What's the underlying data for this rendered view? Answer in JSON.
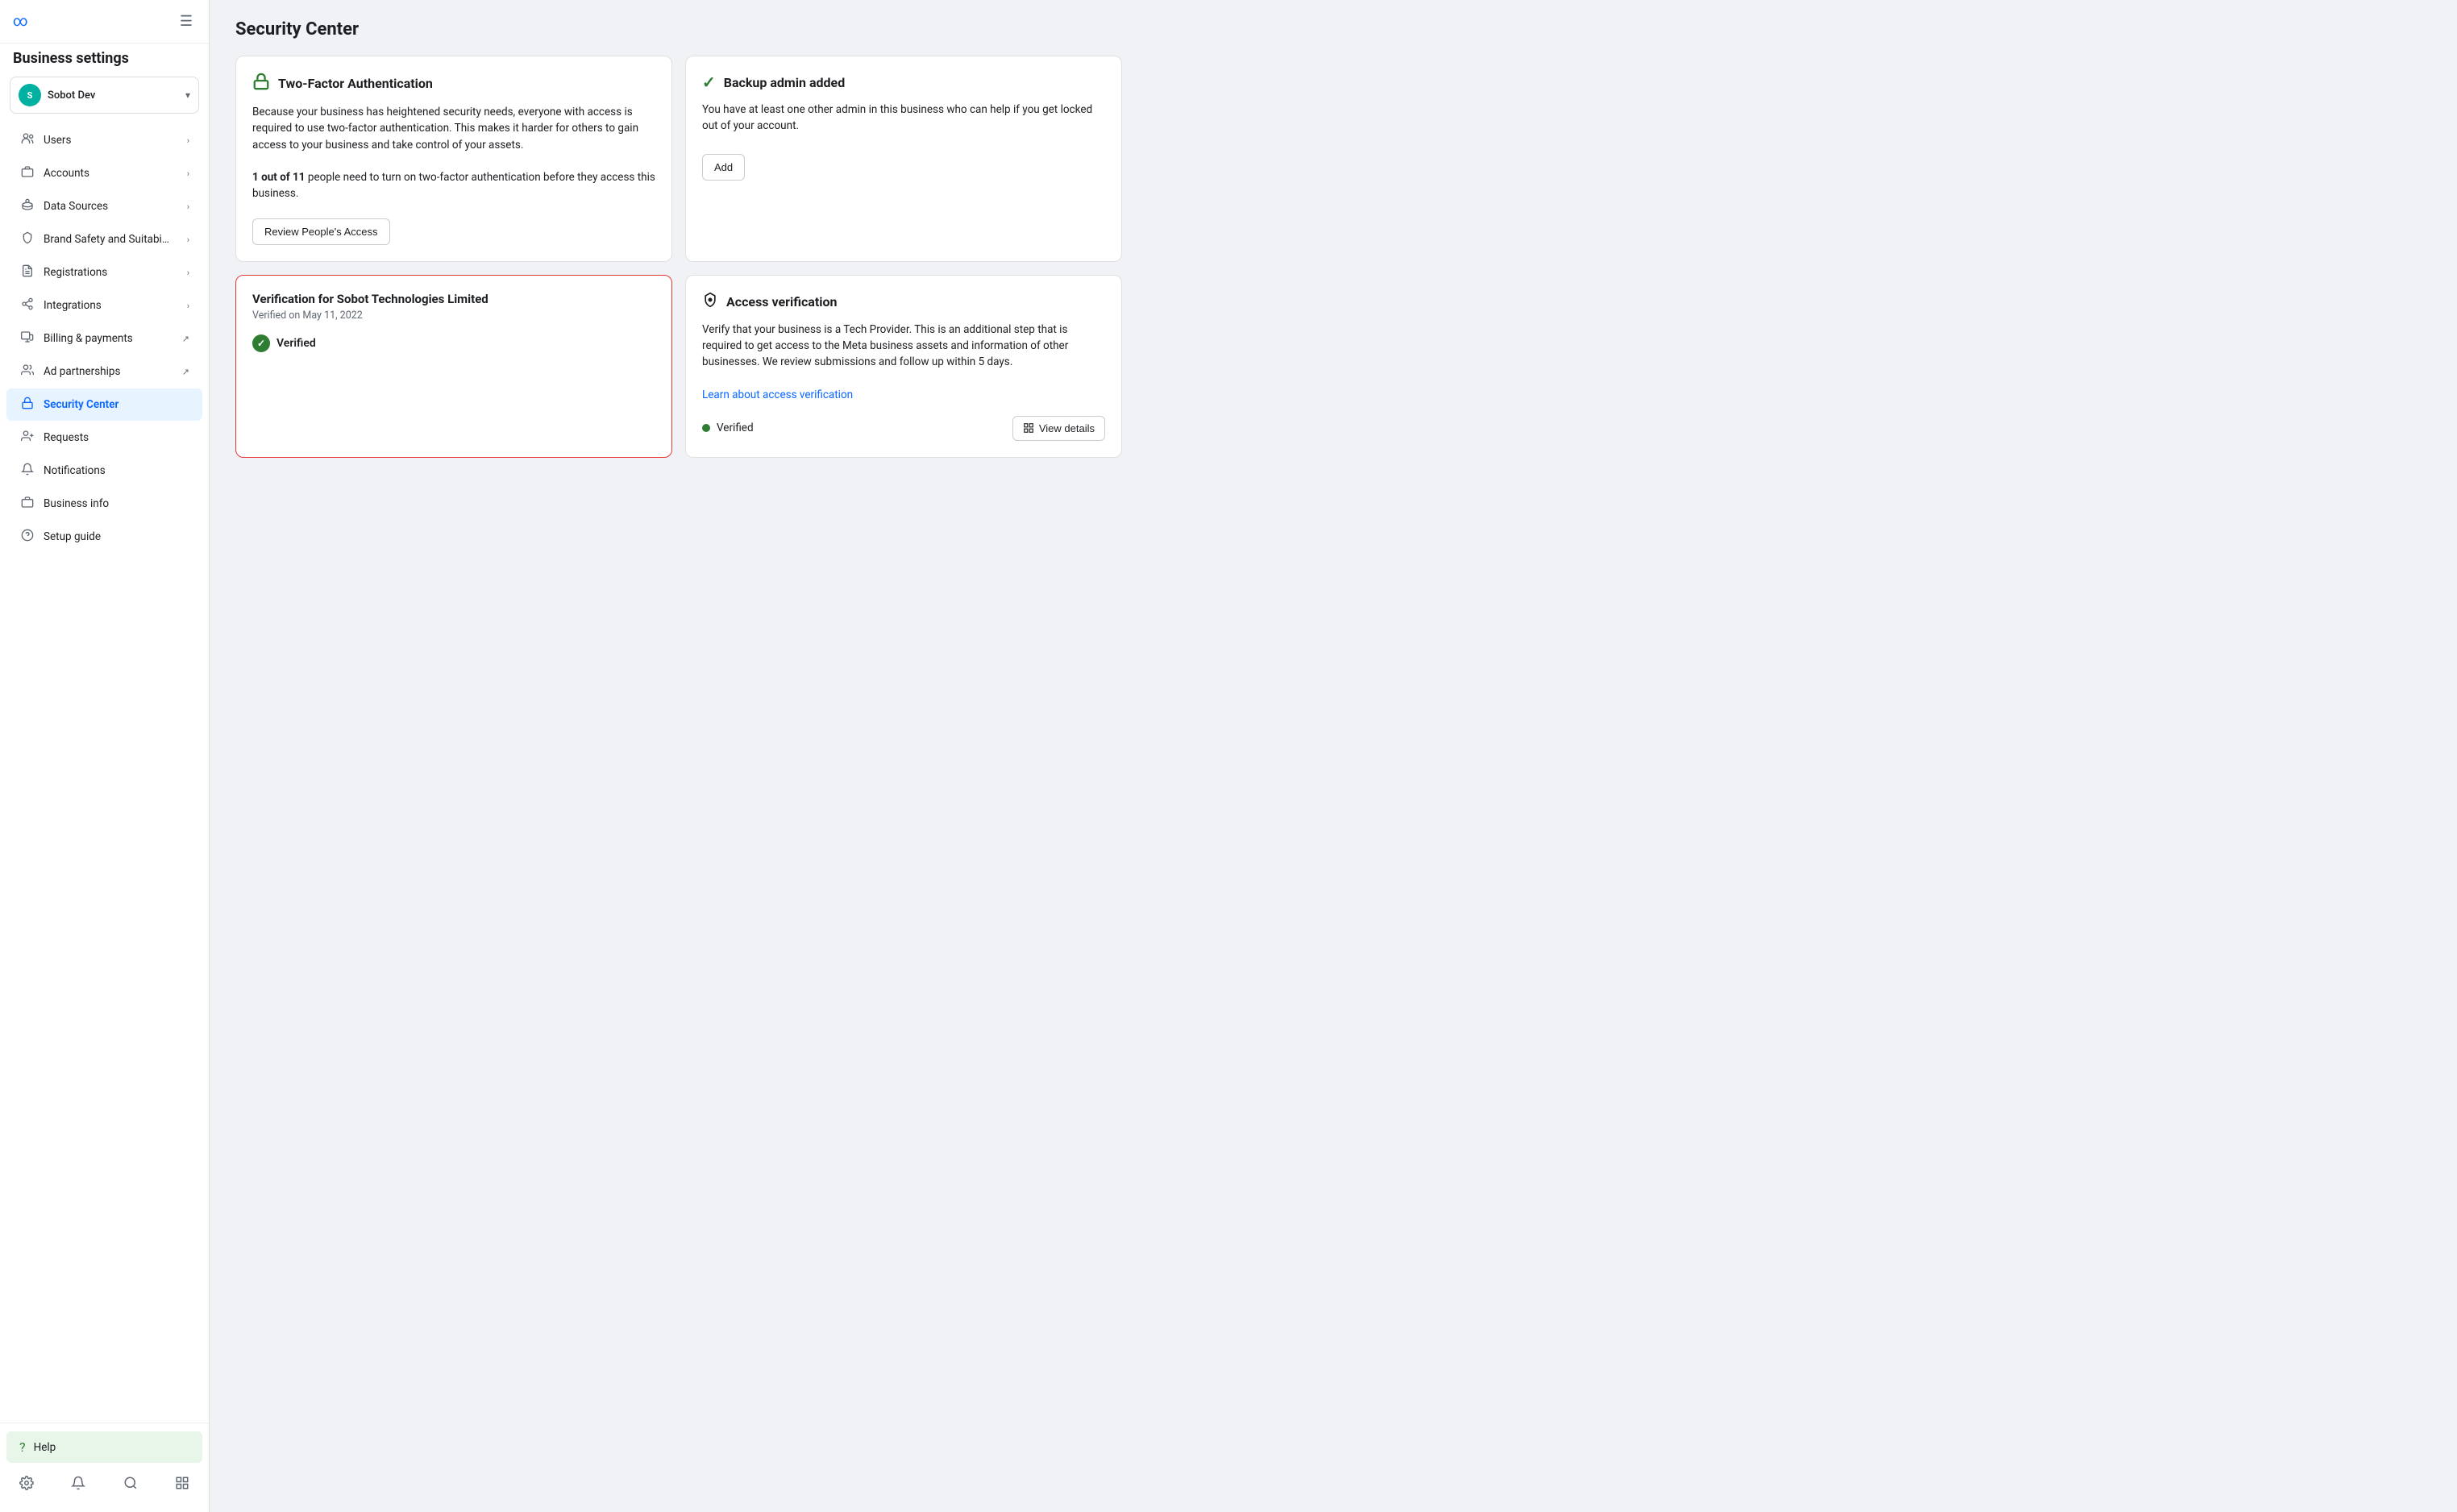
{
  "app": {
    "logo_text": "∞",
    "title": "Business settings"
  },
  "account": {
    "name": "Sobot Dev",
    "initials": "S",
    "avatar_color": "#00b0a0"
  },
  "sidebar": {
    "hamburger_label": "☰",
    "nav_items": [
      {
        "id": "users",
        "label": "Users",
        "icon": "👤",
        "has_chevron": true,
        "active": false,
        "external": false
      },
      {
        "id": "accounts",
        "label": "Accounts",
        "icon": "🏦",
        "has_chevron": true,
        "active": false,
        "external": false
      },
      {
        "id": "data-sources",
        "label": "Data Sources",
        "icon": "⚙",
        "has_chevron": true,
        "active": false,
        "external": false
      },
      {
        "id": "brand-safety",
        "label": "Brand Safety and Suitabi…",
        "icon": "🛡",
        "has_chevron": true,
        "active": false,
        "external": false
      },
      {
        "id": "registrations",
        "label": "Registrations",
        "icon": "📋",
        "has_chevron": true,
        "active": false,
        "external": false
      },
      {
        "id": "integrations",
        "label": "Integrations",
        "icon": "🔗",
        "has_chevron": true,
        "active": false,
        "external": false
      },
      {
        "id": "billing",
        "label": "Billing & payments",
        "icon": "🛒",
        "has_chevron": false,
        "active": false,
        "external": true
      },
      {
        "id": "ad-partnerships",
        "label": "Ad partnerships",
        "icon": "🤝",
        "has_chevron": false,
        "active": false,
        "external": true
      },
      {
        "id": "security-center",
        "label": "Security Center",
        "icon": "🔒",
        "has_chevron": false,
        "active": true,
        "external": false
      },
      {
        "id": "requests",
        "label": "Requests",
        "icon": "👥",
        "has_chevron": false,
        "active": false,
        "external": false
      },
      {
        "id": "notifications",
        "label": "Notifications",
        "icon": "🔔",
        "has_chevron": false,
        "active": false,
        "external": false
      },
      {
        "id": "business-info",
        "label": "Business info",
        "icon": "💼",
        "has_chevron": false,
        "active": false,
        "external": false
      },
      {
        "id": "setup-guide",
        "label": "Setup guide",
        "icon": "❓",
        "has_chevron": false,
        "active": false,
        "external": false
      }
    ],
    "help_label": "Help",
    "footer_icons": [
      "⚙",
      "🔔",
      "🔍",
      "▦"
    ]
  },
  "page": {
    "title": "Security Center"
  },
  "cards": {
    "two_factor": {
      "title": "Two-Factor Authentication",
      "icon": "🔒",
      "body_text": "Because your business has heightened security needs, everyone with access is required to use two-factor authentication. This makes it harder for others to gain access to your business and take control of your assets.",
      "count_text_bold": "1 out of 11",
      "count_text_rest": " people need to turn on two-factor authentication before they access this business.",
      "button_label": "Review People's Access"
    },
    "backup_admin": {
      "title": "Backup admin added",
      "icon": "✓",
      "body_text": "You have at least one other admin in this business who can help if you get locked out of your account.",
      "button_label": "Add"
    },
    "verification": {
      "title": "Verification for Sobot Technologies Limited",
      "date": "Verified on May 11, 2022",
      "verified_label": "Verified"
    },
    "access_verification": {
      "title": "Access verification",
      "body_text": "Verify that your business is a Tech Provider. This is an additional step that is required to get access to the Meta business assets and information of other businesses. We review submissions and follow up within 5 days.",
      "link_label": "Learn about access verification",
      "status_label": "Verified",
      "view_details_label": "View details"
    }
  }
}
